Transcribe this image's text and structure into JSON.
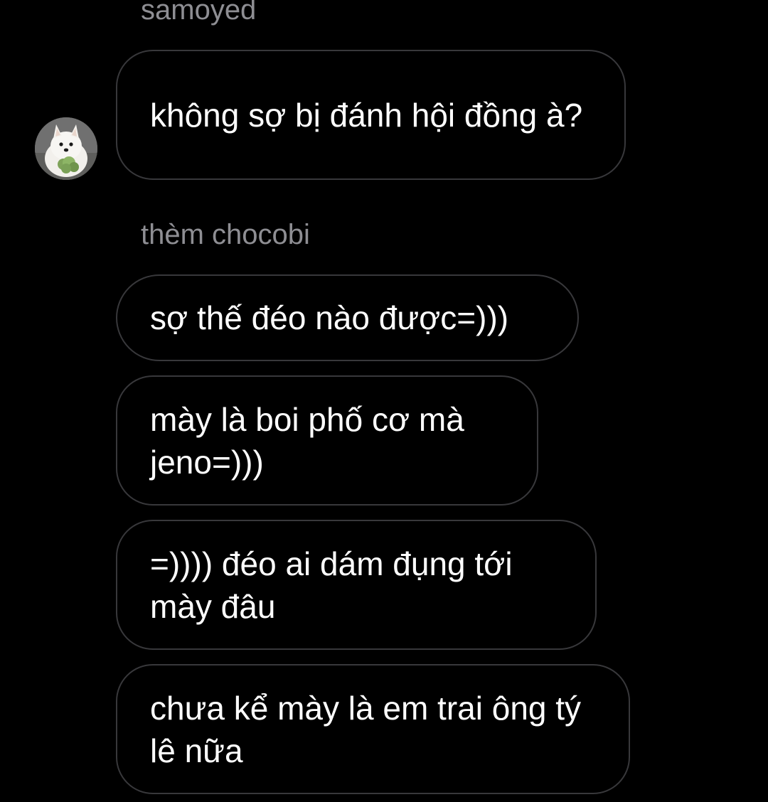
{
  "thread": {
    "groups": [
      {
        "sender": "samoyed",
        "avatar": "samoyed-dog-avatar",
        "messages": [
          {
            "text": "không sợ bị đánh hội đồng à?"
          }
        ]
      },
      {
        "sender": "thèm chocobi",
        "messages": [
          {
            "text": "sợ thế đéo nào được=)))"
          },
          {
            "text": "mày là boi phố cơ mà jeno=)))"
          },
          {
            "text": "=)))) đéo ai dám đụng tới mày đâu"
          },
          {
            "text": "chưa kể mày là em trai ông tý lê nữa"
          }
        ]
      }
    ]
  },
  "colors": {
    "background": "#000000",
    "bubble_border": "#38383b",
    "sender_label": "#8e8e93",
    "message_text": "#ffffff"
  }
}
